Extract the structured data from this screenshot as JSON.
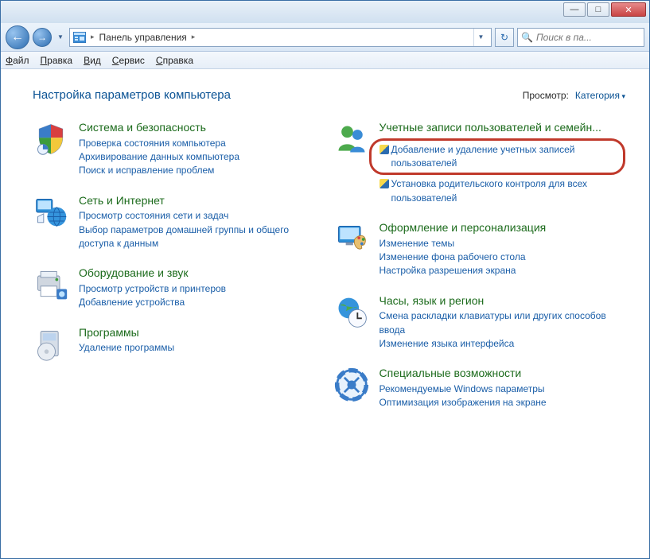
{
  "titlebar": {
    "minimize": "—",
    "maximize": "□",
    "close": "✕"
  },
  "navbar": {
    "back": "←",
    "forward": "→",
    "breadcrumb_root": "Панель управления",
    "refresh": "↻"
  },
  "search": {
    "placeholder": "Поиск в па..."
  },
  "menubar": {
    "file": "Файл",
    "edit": "Правка",
    "view": "Вид",
    "service": "Сервис",
    "help": "Справка"
  },
  "header": {
    "title": "Настройка параметров компьютера",
    "view_label": "Просмотр:",
    "view_value": "Категория"
  },
  "categories": {
    "left": [
      {
        "title": "Система и безопасность",
        "links": [
          {
            "text": "Проверка состояния компьютера"
          },
          {
            "text": "Архивирование данных компьютера"
          },
          {
            "text": "Поиск и исправление проблем"
          }
        ]
      },
      {
        "title": "Сеть и Интернет",
        "links": [
          {
            "text": "Просмотр состояния сети и задач"
          },
          {
            "text": "Выбор параметров домашней группы и общего доступа к данным"
          }
        ]
      },
      {
        "title": "Оборудование и звук",
        "links": [
          {
            "text": "Просмотр устройств и принтеров"
          },
          {
            "text": "Добавление устройства"
          }
        ]
      },
      {
        "title": "Программы",
        "links": [
          {
            "text": "Удаление программы"
          }
        ]
      }
    ],
    "right": [
      {
        "title": "Учетные записи пользователей и семейн...",
        "links": [
          {
            "text": "Добавление и удаление учетных записей пользователей",
            "shield": true,
            "highlight": true
          },
          {
            "text": "Установка родительского контроля для всех пользователей",
            "shield": true
          }
        ]
      },
      {
        "title": "Оформление и персонализация",
        "links": [
          {
            "text": "Изменение темы"
          },
          {
            "text": "Изменение фона рабочего стола"
          },
          {
            "text": "Настройка разрешения экрана"
          }
        ]
      },
      {
        "title": "Часы, язык и регион",
        "links": [
          {
            "text": "Смена раскладки клавиатуры или других способов ввода"
          },
          {
            "text": "Изменение языка интерфейса"
          }
        ]
      },
      {
        "title": "Специальные возможности",
        "links": [
          {
            "text": "Рекомендуемые Windows параметры"
          },
          {
            "text": "Оптимизация изображения на экране"
          }
        ]
      }
    ]
  }
}
